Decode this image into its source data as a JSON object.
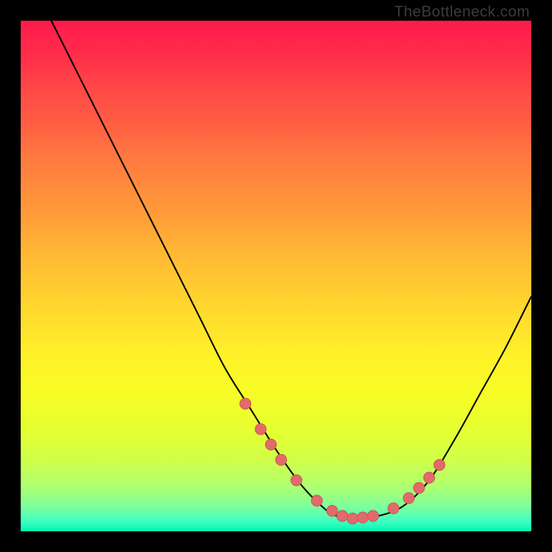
{
  "watermark": "TheBottleneck.com",
  "colors": {
    "bg": "#000000",
    "curve_stroke": "#000000",
    "marker_fill": "#e26a6a",
    "marker_stroke": "#c95555"
  },
  "chart_data": {
    "type": "line",
    "title": "",
    "xlabel": "",
    "ylabel": "",
    "xlim": [
      0,
      100
    ],
    "ylim": [
      0,
      100
    ],
    "series": [
      {
        "name": "bottleneck-curve",
        "x": [
          0,
          5,
          10,
          15,
          20,
          25,
          30,
          35,
          40,
          45,
          50,
          55,
          60,
          62,
          65,
          70,
          75,
          80,
          85,
          90,
          95,
          100
        ],
        "values": [
          112,
          102,
          92,
          82,
          72,
          62,
          52,
          42,
          32,
          24,
          16,
          9,
          4,
          3,
          2.5,
          3,
          5,
          10,
          18,
          27,
          36,
          46
        ]
      }
    ],
    "markers": {
      "name": "highlight-points",
      "x": [
        44,
        47,
        49,
        51,
        54,
        58,
        61,
        63,
        65,
        67,
        69,
        73,
        76,
        78,
        80,
        82
      ],
      "values": [
        25,
        20,
        17,
        14,
        10,
        6,
        4,
        3,
        2.5,
        2.7,
        3,
        4.5,
        6.5,
        8.5,
        10.5,
        13
      ]
    }
  }
}
